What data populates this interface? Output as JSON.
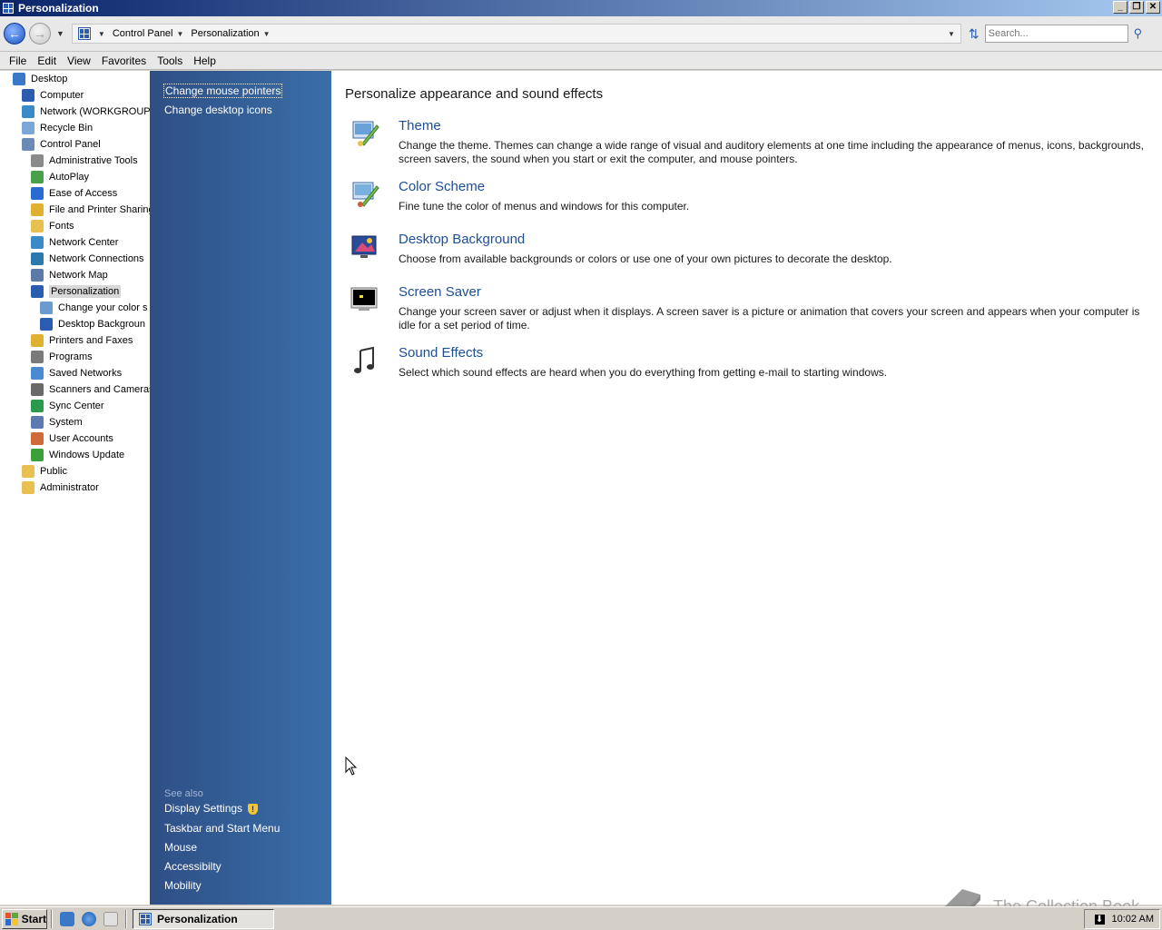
{
  "window": {
    "title": "Personalization"
  },
  "address": {
    "crumbs": [
      "Control Panel",
      "Personalization"
    ],
    "search_placeholder": "Search..."
  },
  "menu": [
    "File",
    "Edit",
    "View",
    "Favorites",
    "Tools",
    "Help"
  ],
  "tree": [
    {
      "label": "Desktop",
      "level": 0,
      "icon": "desktop-icon",
      "color": "#3a78c8"
    },
    {
      "label": "Computer",
      "level": 1,
      "icon": "computer-icon",
      "color": "#2a5db0"
    },
    {
      "label": "Network (WORKGROUP",
      "level": 1,
      "icon": "network-icon",
      "color": "#3a8ac8"
    },
    {
      "label": "Recycle Bin",
      "level": 1,
      "icon": "recycle-bin-icon",
      "color": "#7aa6d8"
    },
    {
      "label": "Control Panel",
      "level": 1,
      "icon": "control-panel-icon",
      "color": "#6a8ab8"
    },
    {
      "label": "Administrative Tools",
      "level": 2,
      "icon": "admin-tools-icon",
      "color": "#8a8a8a"
    },
    {
      "label": "AutoPlay",
      "level": 2,
      "icon": "autoplay-icon",
      "color": "#4aa04a"
    },
    {
      "label": "Ease of Access",
      "level": 2,
      "icon": "ease-of-access-icon",
      "color": "#2a6bd1"
    },
    {
      "label": "File and Printer Sharing",
      "level": 2,
      "icon": "file-sharing-icon",
      "color": "#e0b030"
    },
    {
      "label": "Fonts",
      "level": 2,
      "icon": "fonts-icon",
      "color": "#e8c050"
    },
    {
      "label": "Network Center",
      "level": 2,
      "icon": "network-center-icon",
      "color": "#3a8ac8"
    },
    {
      "label": "Network Connections",
      "level": 2,
      "icon": "network-connections-icon",
      "color": "#2a7ab0"
    },
    {
      "label": "Network Map",
      "level": 2,
      "icon": "network-map-icon",
      "color": "#5a7aa8"
    },
    {
      "label": "Personalization",
      "level": 2,
      "icon": "personalization-icon",
      "color": "#2a5db0",
      "selected": true
    },
    {
      "label": "Change your color s",
      "level": 3,
      "icon": "color-scheme-icon",
      "color": "#6a9ad0"
    },
    {
      "label": "Desktop Backgroun",
      "level": 3,
      "icon": "desktop-background-icon",
      "color": "#2a5db0"
    },
    {
      "label": "Printers and Faxes",
      "level": 2,
      "icon": "printer-icon",
      "color": "#e0b030"
    },
    {
      "label": "Programs",
      "level": 2,
      "icon": "programs-icon",
      "color": "#7a7a7a"
    },
    {
      "label": "Saved Networks",
      "level": 2,
      "icon": "saved-networks-icon",
      "color": "#4a8ad0"
    },
    {
      "label": "Scanners and Cameras",
      "level": 2,
      "icon": "scanner-icon",
      "color": "#6a6a6a"
    },
    {
      "label": "Sync Center",
      "level": 2,
      "icon": "sync-center-icon",
      "color": "#2a9a4a"
    },
    {
      "label": "System",
      "level": 2,
      "icon": "system-icon",
      "color": "#5a7ab0"
    },
    {
      "label": "User Accounts",
      "level": 2,
      "icon": "user-accounts-icon",
      "color": "#d06a3a"
    },
    {
      "label": "Windows Update",
      "level": 2,
      "icon": "windows-update-icon",
      "color": "#3aa03a"
    },
    {
      "label": "Public",
      "level": 1,
      "icon": "folder-icon",
      "color": "#e8c050"
    },
    {
      "label": "Administrator",
      "level": 1,
      "icon": "folder-icon",
      "color": "#e8c050"
    }
  ],
  "tasks": {
    "links": [
      "Change mouse pointers",
      "Change desktop icons"
    ],
    "see_also_title": "See also",
    "see_also": [
      "Display Settings",
      "Taskbar and Start Menu",
      "Mouse",
      "Accessibilty",
      "Mobility"
    ]
  },
  "content": {
    "heading": "Personalize appearance and sound effects",
    "items": [
      {
        "title": "Theme",
        "desc": "Change the theme. Themes can change a wide range of visual and auditory elements at one time including the appearance of menus, icons, backgrounds, screen savers, the sound when you start or exit the computer, and mouse pointers.",
        "icon": "theme-icon"
      },
      {
        "title": "Color Scheme",
        "desc": "Fine tune the color of menus and windows for this computer.",
        "icon": "color-scheme-icon"
      },
      {
        "title": "Desktop Background",
        "desc": "Choose from available backgrounds or colors or use one of your own pictures to decorate the desktop.",
        "icon": "desktop-background-icon"
      },
      {
        "title": "Screen Saver",
        "desc": "Change your screen saver or adjust when it displays. A screen saver is a picture or animation that covers your screen and appears when your computer is idle for a set period of time.",
        "icon": "screen-saver-icon"
      },
      {
        "title": "Sound Effects",
        "desc": "Select which sound effects are heard when you do everything from getting e-mail to starting windows.",
        "icon": "sound-effects-icon"
      }
    ]
  },
  "taskbar": {
    "start": "Start",
    "active_window": "Personalization",
    "clock": "10:02 AM"
  },
  "watermark": "The Collection Book"
}
